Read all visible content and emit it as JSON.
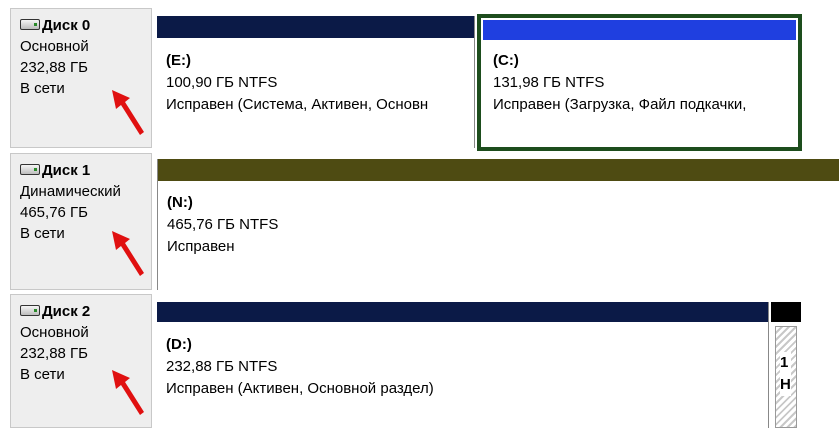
{
  "disks": [
    {
      "name": "Диск 0",
      "type": "Основной",
      "size": "232,88 ГБ",
      "status": "В сети",
      "partitions": [
        {
          "letter": "(E:)",
          "size_fs": "100,90 ГБ NTFS",
          "health": "Исправен (Система, Активен, Основн",
          "bar_color": "#0b1a47"
        },
        {
          "letter": "(C:)",
          "size_fs": "131,98 ГБ NTFS",
          "health": "Исправен (Загрузка, Файл подкачки,",
          "bar_color": "#1f3fe0",
          "selected": true
        }
      ]
    },
    {
      "name": "Диск 1",
      "type": "Динамический",
      "size": "465,76 ГБ",
      "status": "В сети",
      "partitions": [
        {
          "letter": "(N:)",
          "size_fs": "465,76 ГБ NTFS",
          "health": "Исправен",
          "bar_color": "#4e4b12"
        }
      ]
    },
    {
      "name": "Диск 2",
      "type": "Основной",
      "size": "232,88 ГБ",
      "status": "В сети",
      "partitions": [
        {
          "letter": "(D:)",
          "size_fs": "232,88 ГБ NTFS",
          "health": "Исправен (Активен, Основной раздел)",
          "bar_color": "#0b1a47"
        },
        {
          "line1": "1",
          "line2": "Н",
          "bar_color": "#000000"
        }
      ]
    }
  ],
  "colors": {
    "arrow": "#e01010",
    "selected_border": "#1d4d1d",
    "info_bg": "#eeeeee"
  }
}
